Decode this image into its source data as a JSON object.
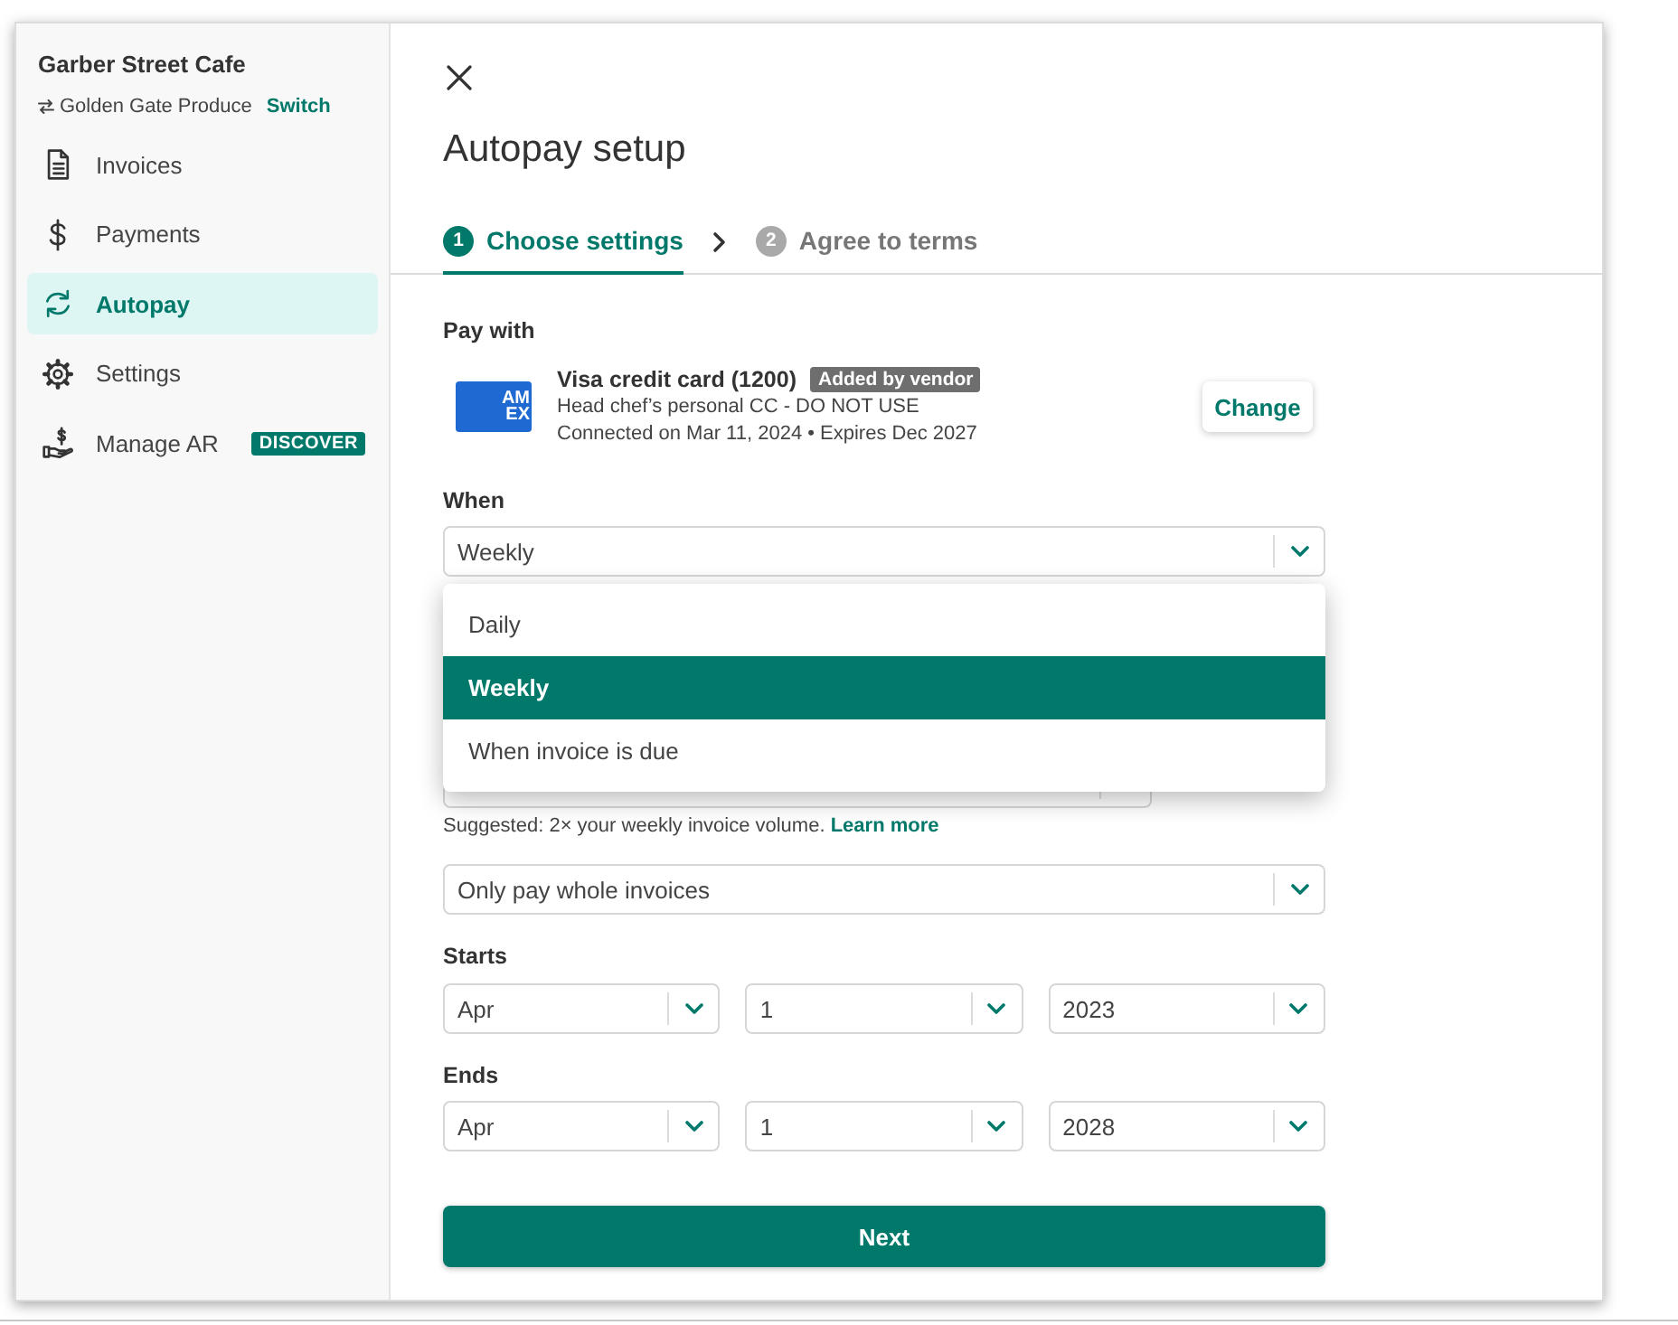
{
  "sidebar": {
    "business_name": "Garber Street Cafe",
    "vendor_name": "Golden Gate Produce",
    "switch_link": "Switch",
    "nav": [
      {
        "label": "Invoices",
        "selected": false
      },
      {
        "label": "Payments",
        "selected": false
      },
      {
        "label": "Autopay",
        "selected": true
      },
      {
        "label": "Settings",
        "selected": false
      },
      {
        "label": "Manage AR",
        "selected": false,
        "badge": "DISCOVER"
      }
    ]
  },
  "title": "Autopay setup",
  "steps": [
    {
      "number": "1",
      "label": "Choose settings",
      "selected": true
    },
    {
      "number": "2",
      "label": "Agree to terms",
      "selected": false
    }
  ],
  "pay_with": {
    "label": "Pay with",
    "card_logo": [
      "AM",
      "EX"
    ],
    "card_name": "Visa credit card (1200)",
    "badge": "Added by vendor",
    "nickname": "Head chef’s personal CC - DO NOT USE",
    "details": "Connected on Mar 11, 2024 • Expires Dec 2027",
    "change_button": "Change"
  },
  "when": {
    "label": "When",
    "value": "Weekly",
    "expanded": true,
    "options": [
      {
        "label": "Daily",
        "selected": false
      },
      {
        "label": "Weekly",
        "selected": true
      },
      {
        "label": "When invoice is due",
        "selected": false
      }
    ]
  },
  "hint": {
    "text": "Suggested: 2× your weekly invoice volume.",
    "link": "Learn more"
  },
  "payment_rule": {
    "value": "Only pay whole invoices"
  },
  "starts": {
    "label": "Starts",
    "fields": [
      {
        "value": "Apr"
      },
      {
        "value": "1"
      },
      {
        "value": "2023"
      }
    ]
  },
  "ends": {
    "label": "Ends",
    "fields": [
      {
        "value": "Apr"
      },
      {
        "value": "1"
      },
      {
        "value": "2028"
      }
    ]
  },
  "next_button": "Next"
}
